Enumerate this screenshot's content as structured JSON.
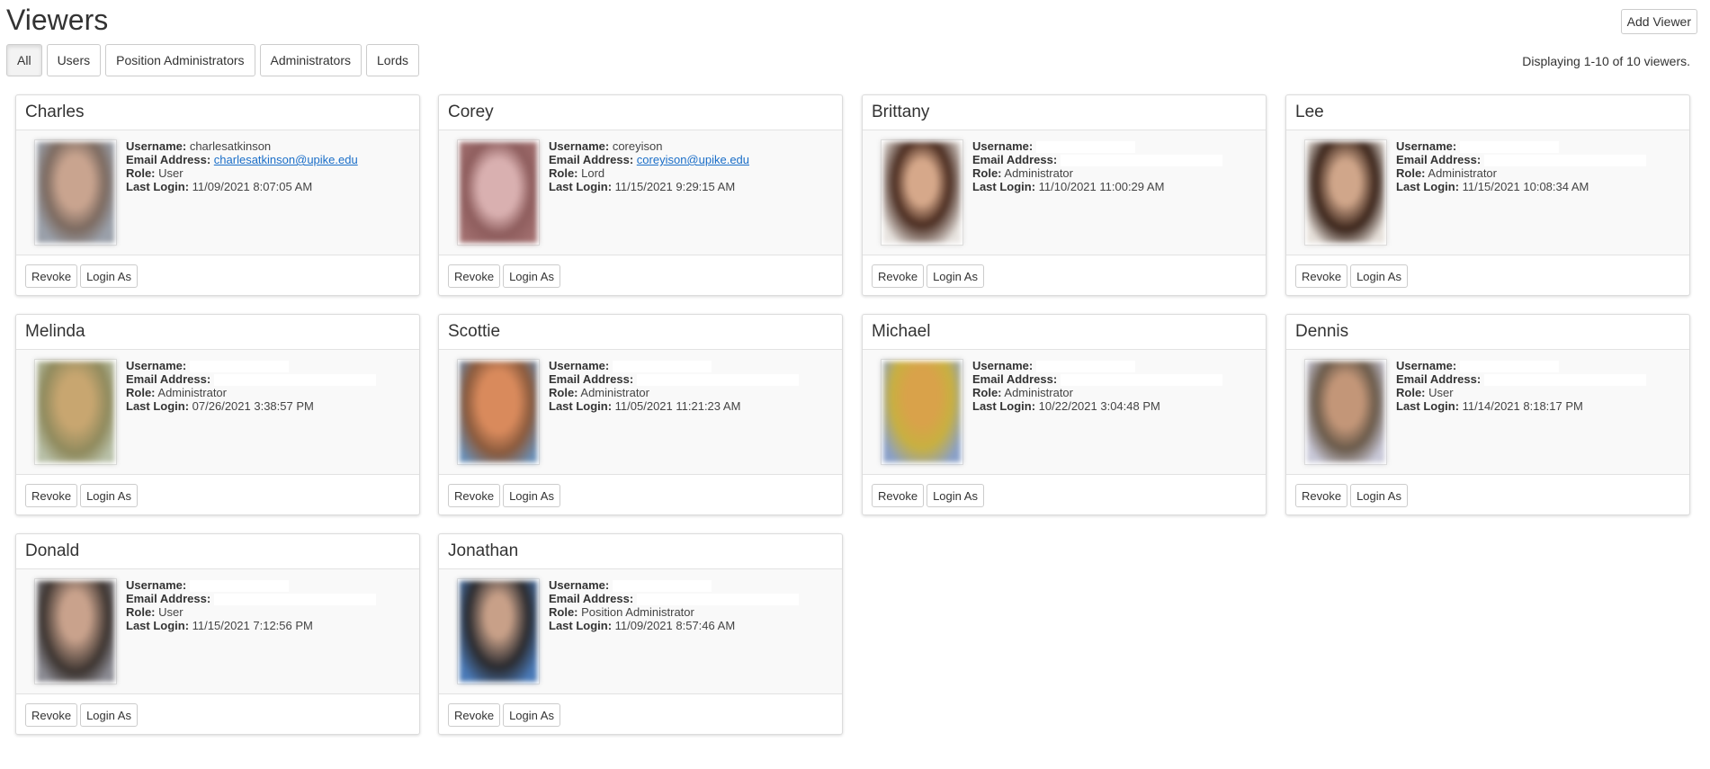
{
  "header": {
    "title": "Viewers",
    "add_label": "Add Viewer"
  },
  "filters": [
    "All",
    "Users",
    "Position Administrators",
    "Administrators",
    "Lords"
  ],
  "display_count": "Displaying 1-10 of 10 viewers.",
  "labels": {
    "username": "Username:",
    "email": "Email Address:",
    "role": "Role:",
    "last_login": "Last Login:",
    "revoke": "Revoke",
    "login_as": "Login As"
  },
  "viewers": [
    {
      "name": "Charles",
      "username": "charlesatkinson",
      "email": "charlesatkinson@upike.edu",
      "role": "User",
      "last_login": "11/09/2021 8:07:05 AM"
    },
    {
      "name": "Corey",
      "username": "coreyison",
      "email": "coreyison@upike.edu",
      "role": "Lord",
      "last_login": "11/15/2021 9:29:15 AM"
    },
    {
      "name": "Brittany",
      "username": "",
      "email": "",
      "role": "Administrator",
      "last_login": "11/10/2021 11:00:29 AM"
    },
    {
      "name": "Lee",
      "username": "",
      "email": "",
      "role": "Administrator",
      "last_login": "11/15/2021 10:08:34 AM"
    },
    {
      "name": "Melinda",
      "username": "",
      "email": "",
      "role": "Administrator",
      "last_login": "07/26/2021 3:38:57 PM"
    },
    {
      "name": "Scottie",
      "username": "",
      "email": "",
      "role": "Administrator",
      "last_login": "11/05/2021 11:21:23 AM"
    },
    {
      "name": "Michael",
      "username": "",
      "email": "",
      "role": "Administrator",
      "last_login": "10/22/2021 3:04:48 PM"
    },
    {
      "name": "Dennis",
      "username": "",
      "email": "",
      "role": "User",
      "last_login": "11/14/2021 8:18:17 PM"
    },
    {
      "name": "Donald",
      "username": "",
      "email": "",
      "role": "User",
      "last_login": "11/15/2021 7:12:56 PM"
    },
    {
      "name": "Jonathan",
      "username": "",
      "email": "",
      "role": "Position Administrator",
      "last_login": "11/09/2021 8:57:46 AM"
    }
  ],
  "colors": {
    "link": "#1a6ec8",
    "card_body": "#f9f9f9",
    "border": "#dcdcdc"
  }
}
